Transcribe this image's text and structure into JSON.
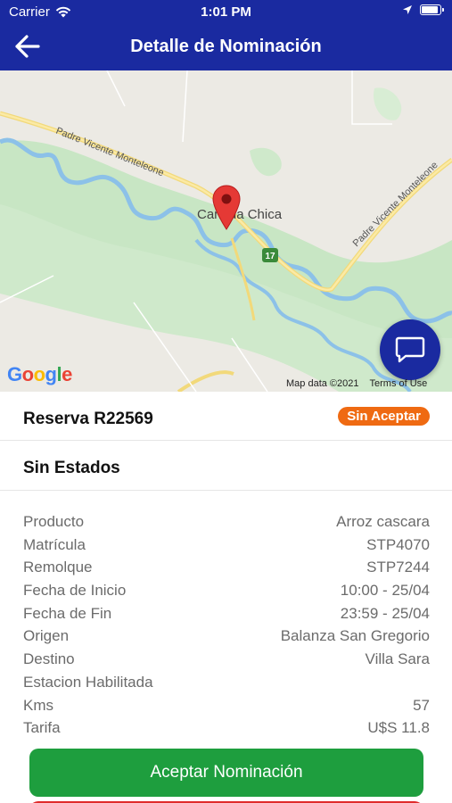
{
  "status_bar": {
    "carrier": "Carrier",
    "time": "1:01 PM",
    "icons": [
      "wifi-icon",
      "location-arrow-icon",
      "battery-icon"
    ]
  },
  "nav": {
    "title": "Detalle de Nominación",
    "back_icon": "arrow-left-icon"
  },
  "map": {
    "road_label_1": "Padre Vicente Monteleone",
    "road_label_2": "Padre Vicente Monteleone",
    "town_label": "Cañada Chica",
    "route_number": "17",
    "google_logo": "Google",
    "map_data": "Map data ©2021",
    "terms": "Terms of Use",
    "marker_icon": "map-pin-icon",
    "chat_icon": "chat-bubble-icon"
  },
  "reserva": {
    "label": "Reserva R22569",
    "status_badge": "Sin Aceptar"
  },
  "estados": {
    "label": "Sin Estados"
  },
  "details": [
    {
      "label": "Producto",
      "value": "Arroz cascara"
    },
    {
      "label": "Matrícula",
      "value": "STP4070"
    },
    {
      "label": "Remolque",
      "value": "STP7244"
    },
    {
      "label": "Fecha de Inicio",
      "value": "10:00 - 25/04"
    },
    {
      "label": "Fecha de Fin",
      "value": "23:59 - 25/04"
    },
    {
      "label": "Origen",
      "value": "Balanza San Gregorio"
    },
    {
      "label": "Destino",
      "value": "Villa Sara"
    },
    {
      "label": "Estacion Habilitada",
      "value": ""
    },
    {
      "label": "Kms",
      "value": "57"
    },
    {
      "label": "Tarifa",
      "value": "U$S 11.8"
    }
  ],
  "actions": {
    "accept_label": "Aceptar Nominación"
  },
  "colors": {
    "primary": "#1a2aa0",
    "badge": "#ef6a12",
    "accept": "#1e9e3e",
    "reject": "#e02b2b"
  }
}
